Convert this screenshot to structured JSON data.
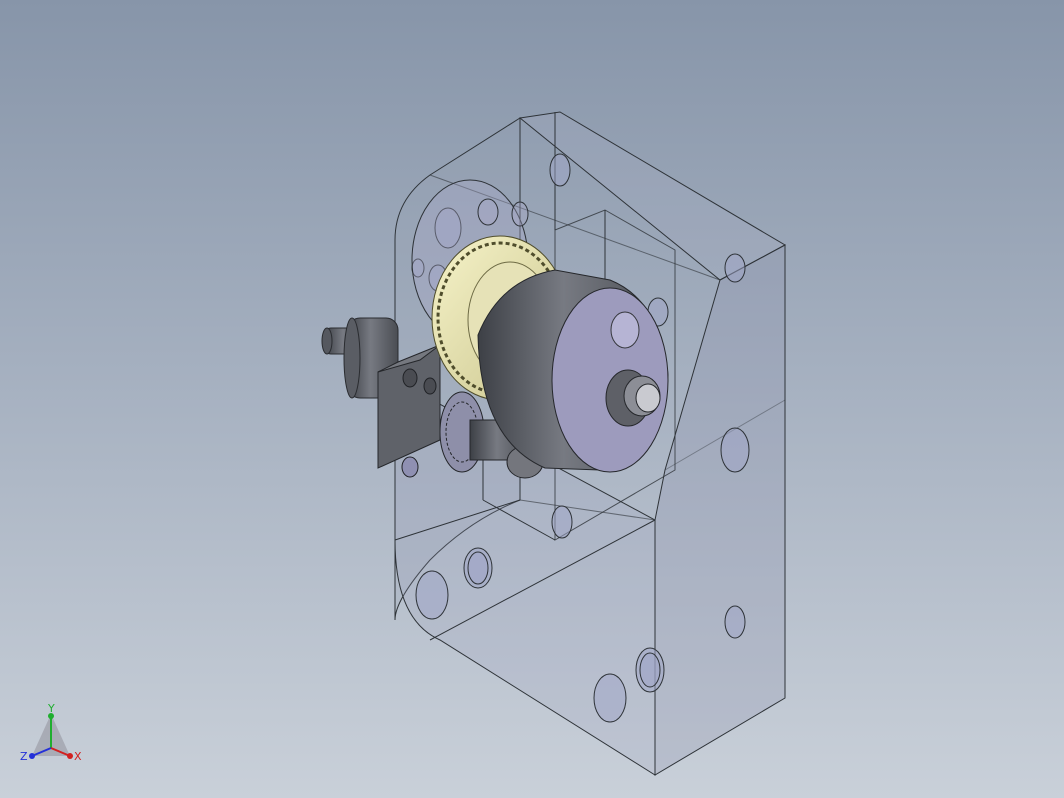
{
  "viewport": {
    "background_top": "#8795a9",
    "background_bottom": "#c9d0d9"
  },
  "model": {
    "housing_edge_color": "#2e3338",
    "gear_color": "#e8e4b0",
    "metal_color": "#6f737b",
    "face_color": "#9d9bbd"
  },
  "triad": {
    "x_label": "X",
    "y_label": "Y",
    "z_label": "Z",
    "x_color": "#d22020",
    "y_color": "#1fae2f",
    "z_color": "#2430d8"
  }
}
